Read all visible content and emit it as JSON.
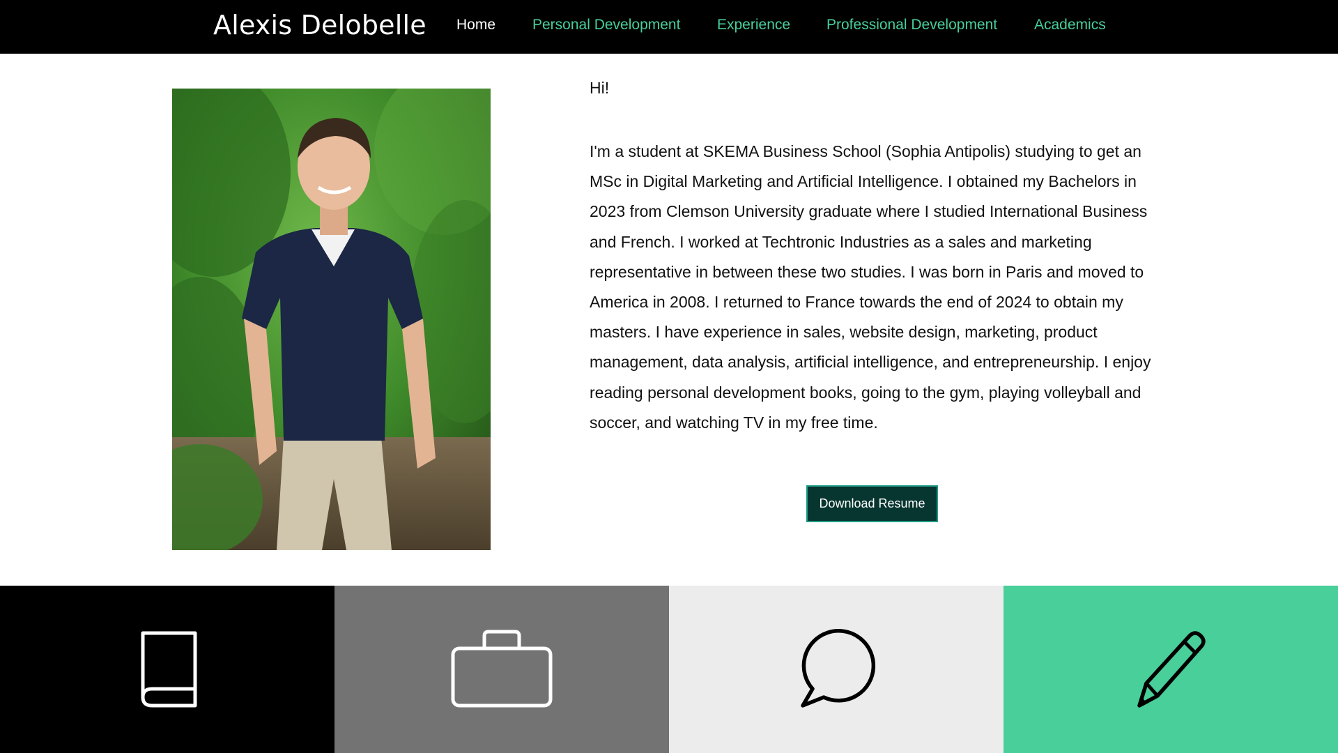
{
  "header": {
    "brand": "Alexis Delobelle",
    "nav": [
      {
        "label": "Home",
        "active": true
      },
      {
        "label": "Personal Development",
        "active": false
      },
      {
        "label": "Experience",
        "active": false
      },
      {
        "label": "Professional Development",
        "active": false
      },
      {
        "label": "Academics",
        "active": false
      }
    ]
  },
  "main": {
    "greeting": "Hi!",
    "bio": "I'm a student at SKEMA Business School (Sophia Antipolis) studying to get an MSc in Digital Marketing and Artificial Intelligence. I obtained my Bachelors in 2023 from Clemson University graduate where I studied International Business and French. I worked at Techtronic Industries as a sales and marketing representative in between these two studies. I was born in Paris and moved to America in 2008. I returned to France towards the end of 2024 to obtain my masters. I have experience in sales, website design, marketing, product management, data analysis, artificial intelligence, and entrepreneurship. I enjoy reading personal development books, going to the gym, playing volleyball and soccer, and watching TV in my free time.",
    "download_label": "Download Resume"
  },
  "tiles": [
    {
      "icon": "book-icon",
      "background": "#000000",
      "icon_color": "#ffffff"
    },
    {
      "icon": "briefcase-icon",
      "background": "#737373",
      "icon_color": "#ffffff"
    },
    {
      "icon": "speech-bubble-icon",
      "background": "#ececec",
      "icon_color": "#000000"
    },
    {
      "icon": "pencil-icon",
      "background": "#48cf9a",
      "icon_color": "#000000"
    }
  ],
  "colors": {
    "accent": "#48cf9a",
    "header_bg": "#000000",
    "button_bg": "#07352f"
  }
}
